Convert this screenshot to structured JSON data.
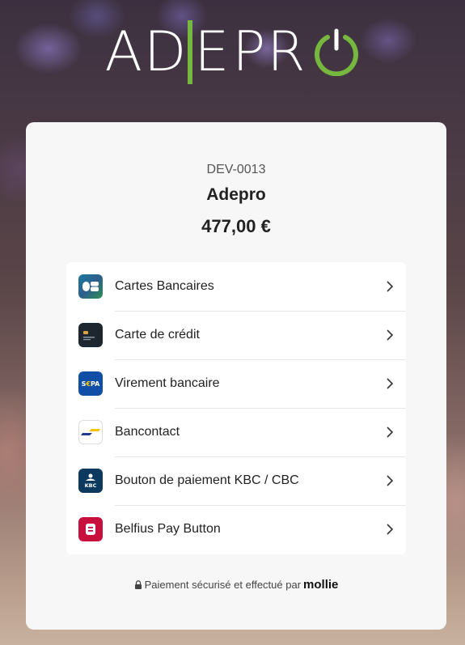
{
  "header": {
    "logo_alt": "ADEPRO"
  },
  "order": {
    "reference": "DEV-0013",
    "merchant": "Adepro",
    "amount": "477,00 €"
  },
  "methods": [
    {
      "label": "Cartes Bancaires",
      "icon": "cartes-bancaires-icon"
    },
    {
      "label": "Carte de crédit",
      "icon": "credit-card-icon"
    },
    {
      "label": "Virement bancaire",
      "icon": "sepa-icon"
    },
    {
      "label": "Bancontact",
      "icon": "bancontact-icon"
    },
    {
      "label": "Bouton de paiement KBC / CBC",
      "icon": "kbc-icon"
    },
    {
      "label": "Belfius Pay Button",
      "icon": "belfius-icon"
    }
  ],
  "footer": {
    "secure_text": "Paiement sécurisé et effectué par",
    "provider": "mollie"
  },
  "colors": {
    "brand_green": "#76b83f",
    "card_bg": "#f7f7f7"
  }
}
